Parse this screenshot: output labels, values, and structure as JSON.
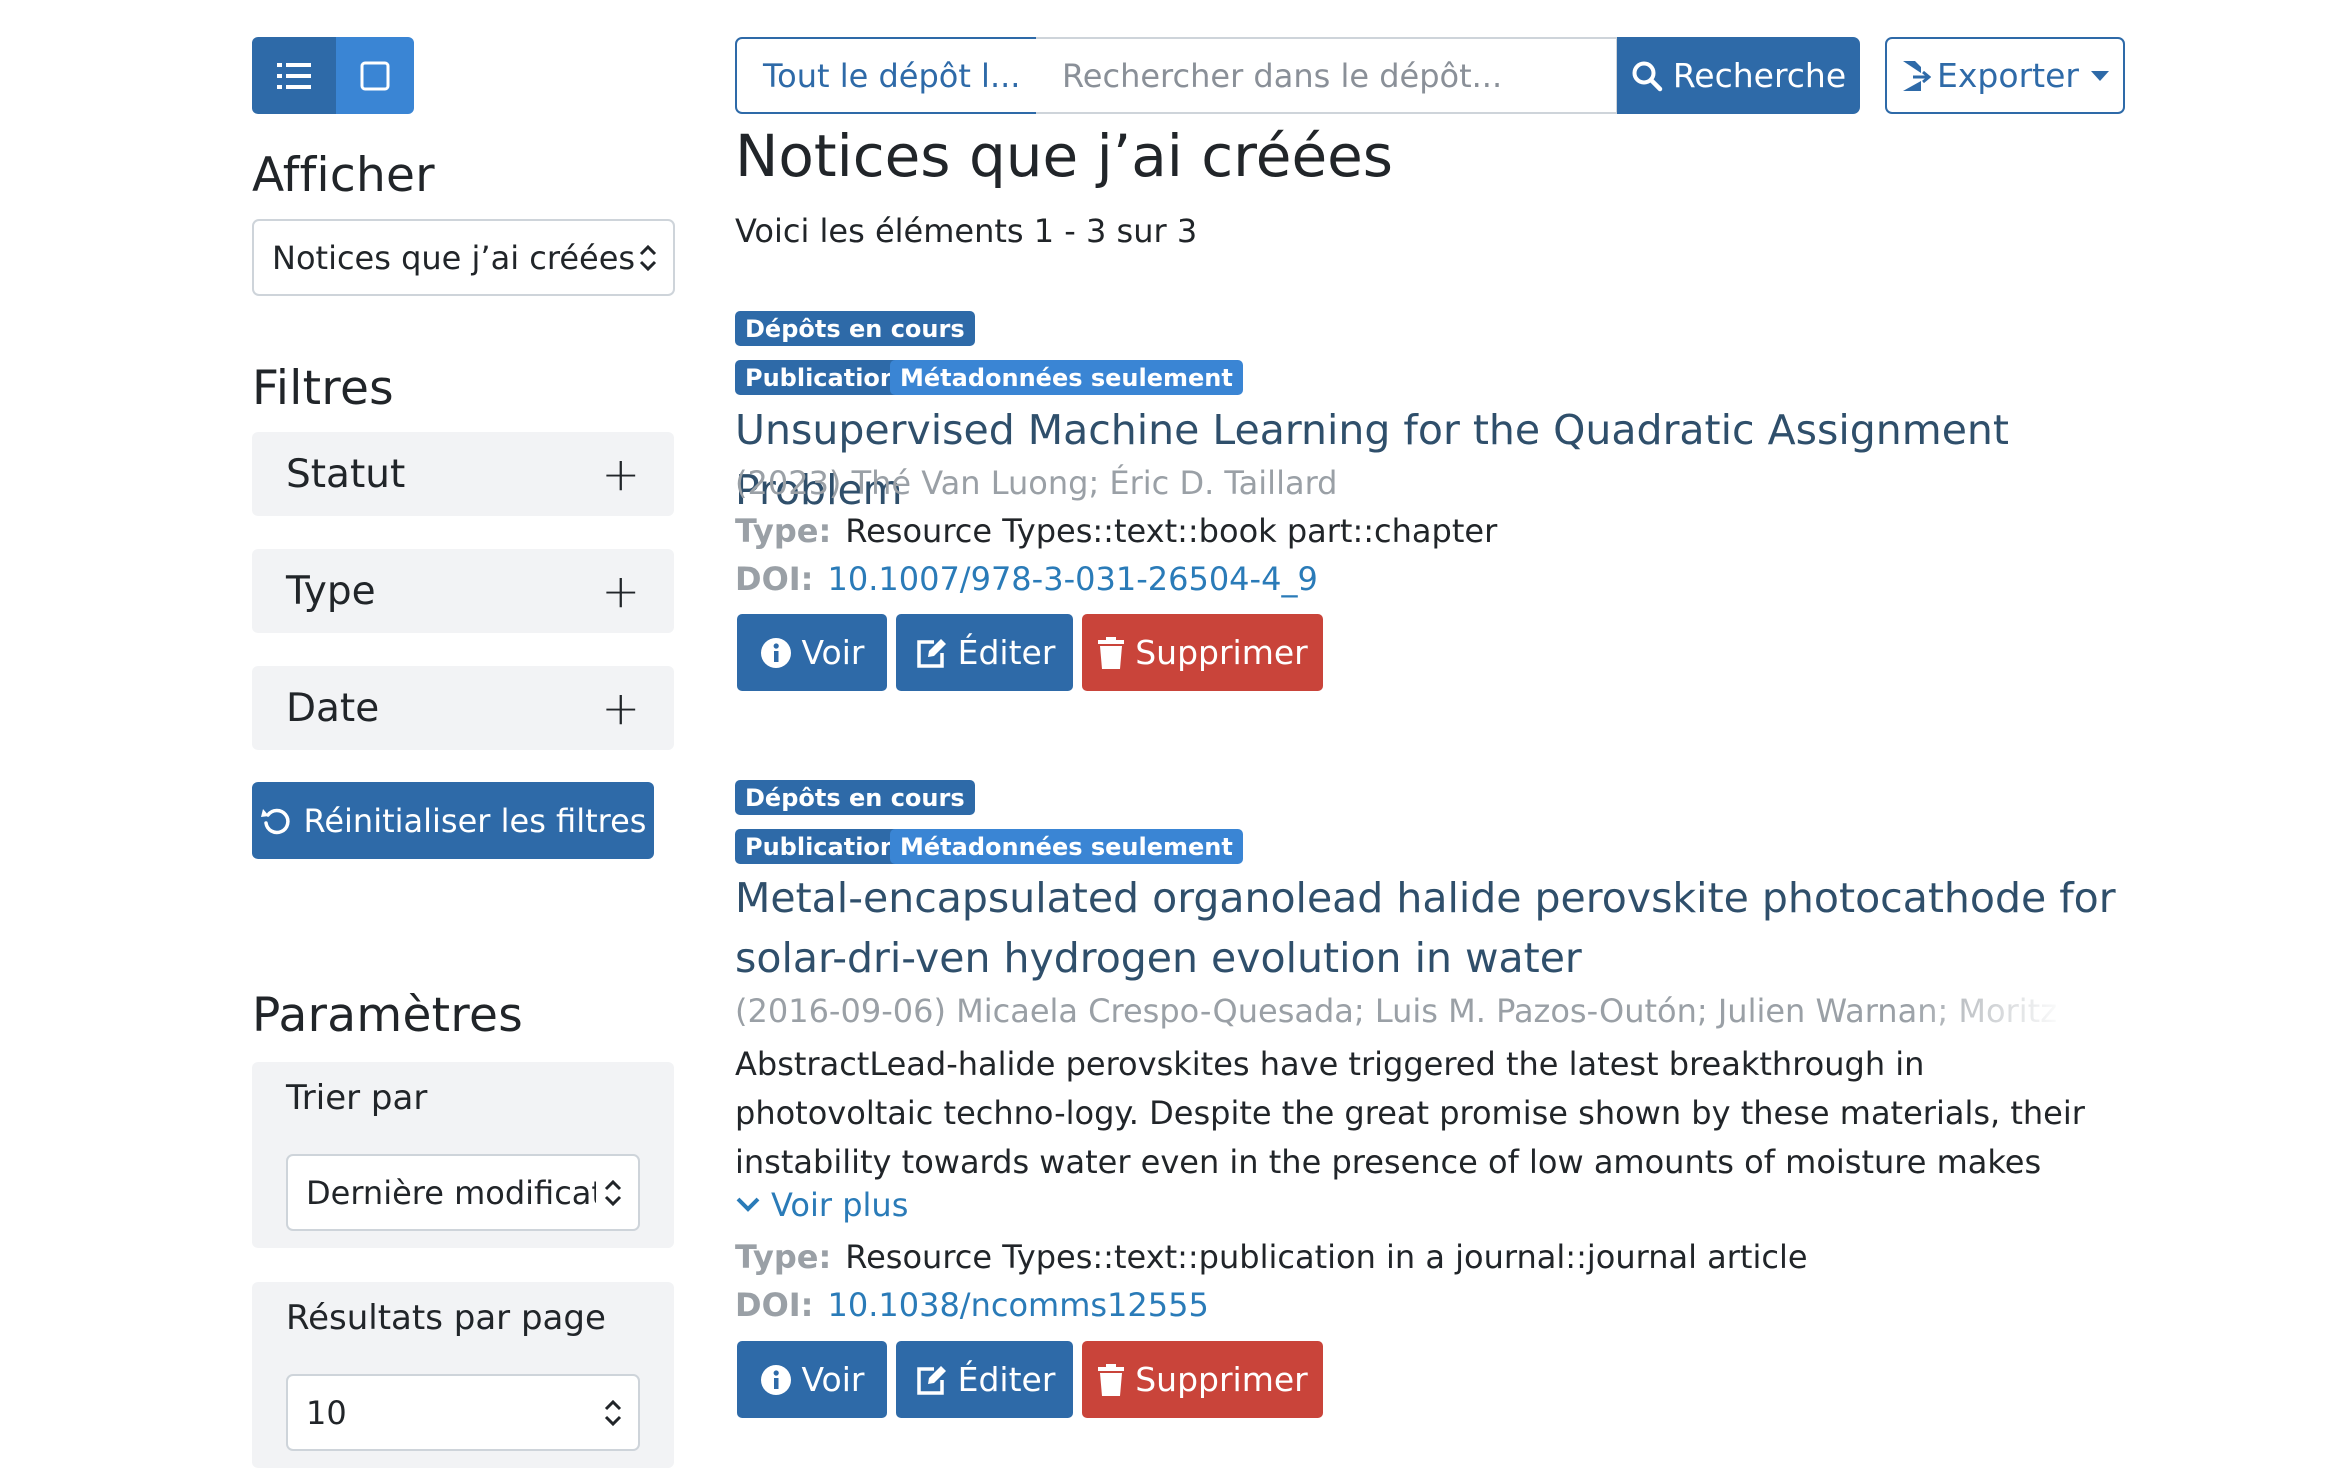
{
  "sidebar": {
    "view_toggle": {
      "list_icon": "list-icon",
      "gallery_icon": "gallery-icon"
    },
    "show_heading": "Afficher",
    "show_select_value": "Notices que j’ai créées",
    "filters_heading": "Filtres",
    "facets": [
      {
        "label": "Statut",
        "toggle": "+"
      },
      {
        "label": "Type",
        "toggle": "+"
      },
      {
        "label": "Date",
        "toggle": "+"
      }
    ],
    "reset_label": "Réinitialiser les filtres",
    "params_heading": "Paramètres",
    "sort_label": "Trier par",
    "sort_value": "Dernière modification",
    "per_page_label": "Résultats par page",
    "per_page_value": "10"
  },
  "search": {
    "scope_label": "Tout le dépôt l...",
    "placeholder": "Rechercher dans le dépôt...",
    "button_label": "Recherche",
    "export_label": "Exporter"
  },
  "main": {
    "title": "Notices que j’ai créées",
    "count": "Voici les éléments 1 - 3 sur 3",
    "results": [
      {
        "status_badge": "Dépôts en cours",
        "type_badge": "Publication",
        "meta_badge": "Métadonnées seulement",
        "title": "Unsupervised Machine Learning for the Quadratic Assignment Problem",
        "meta": "(2023) Thé Van Luong; Éric D. Taillard",
        "type_key": "Type:",
        "type_value": "Resource Types::text::book part::chapter",
        "doi_key": "DOI:",
        "doi_value": "10.1007/978-3-031-26504-4_9",
        "view_label": "Voir",
        "edit_label": "Éditer",
        "delete_label": "Supprimer"
      },
      {
        "status_badge": "Dépôts en cours",
        "type_badge": "Publication",
        "meta_badge": "Métadonnées seulement",
        "title": "Metal-encapsulated organolead halide perovskite photocathode for solar-dri-ven hydrogen evolution in water",
        "meta": "(2016-09-06) Micaela Crespo-Quesada; Luis M. Pazos-Outón; Julien Warnan; Moritz F. Ku",
        "abstract": "AbstractLead-halide perovskites have triggered the latest breakthrough in photovoltaic techno-logy. Despite the great promise shown by these materials, their instability towards water even in the presence of low amounts of moisture makes them, a priori, unsuitable for their direc",
        "see_more": "Voir plus",
        "type_key": "Type:",
        "type_value": "Resource Types::text::publication in a journal::journal article",
        "doi_key": "DOI:",
        "doi_value": "10.1038/ncomms12555",
        "view_label": "Voir",
        "edit_label": "Éditer",
        "delete_label": "Supprimer"
      }
    ]
  },
  "colors": {
    "primary": "#2e6aa8",
    "primary_light": "#3a85d4",
    "danger": "#c9443a",
    "link": "#2a7bb8",
    "muted": "#9aa0a6",
    "panel": "#f2f3f5"
  }
}
